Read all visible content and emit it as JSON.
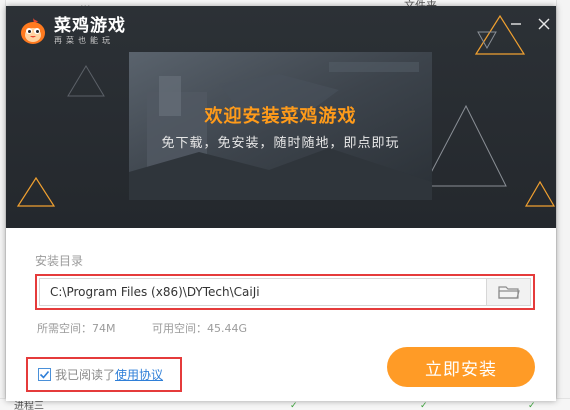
{
  "background": {
    "top_texts": [
      "...",
      "文件夹"
    ],
    "bottom_text": "进程三"
  },
  "installer": {
    "logo": {
      "title": "菜鸡游戏",
      "slogan": "再菜也能玩"
    },
    "banner": {
      "title": "欢迎安装菜鸡游戏",
      "subtitle": "免下载，免安装，随时随地，即点即玩"
    },
    "install_dir": {
      "label": "安装目录",
      "path": "C:\\Program Files (x86)\\DYTech\\CaiJi"
    },
    "space": {
      "required": "所需空间：74M",
      "available": "可用空间：45.44G"
    },
    "agreement": {
      "text": "我已阅读了",
      "link": "使用协议",
      "checked": true
    },
    "install_button": "立即安装",
    "colors": {
      "header_bg": "#2a2f34",
      "accent_orange": "#ff9b26",
      "highlight_red": "#e53b3b",
      "link_blue": "#2f7fd8"
    },
    "icons": [
      "mascot-logo-icon",
      "minimize-icon",
      "close-icon",
      "folder-icon",
      "checkmark-icon"
    ]
  }
}
